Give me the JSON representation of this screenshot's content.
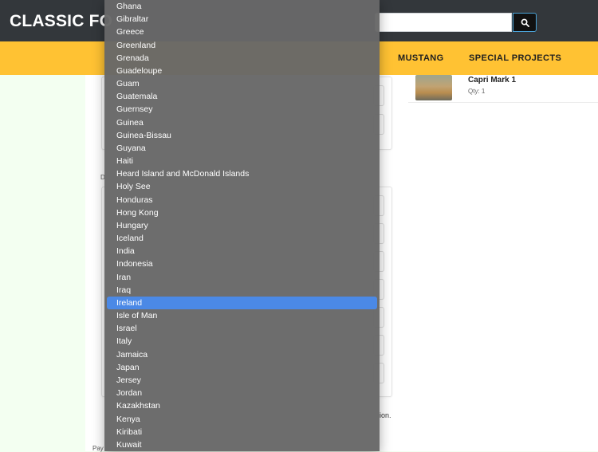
{
  "header": {
    "logo_text": "CLASSIC FO"
  },
  "nav": {
    "mustang": "MUSTANG",
    "special_projects": "SPECIAL PROJECTS"
  },
  "cart": {
    "item_name": "Capri Mark 1",
    "item_qty": "Qty: 1"
  },
  "background_text": {
    "label_d": "D",
    "suffix": "ion.",
    "footer_fragment": "Pay"
  },
  "dropdown": {
    "selected": "Ireland",
    "options": [
      "Ghana",
      "Gibraltar",
      "Greece",
      "Greenland",
      "Grenada",
      "Guadeloupe",
      "Guam",
      "Guatemala",
      "Guernsey",
      "Guinea",
      "Guinea-Bissau",
      "Guyana",
      "Haiti",
      "Heard Island and McDonald Islands",
      "Holy See",
      "Honduras",
      "Hong Kong",
      "Hungary",
      "Iceland",
      "India",
      "Indonesia",
      "Iran",
      "Iraq",
      "Ireland",
      "Isle of Man",
      "Israel",
      "Italy",
      "Jamaica",
      "Japan",
      "Jersey",
      "Jordan",
      "Kazakhstan",
      "Kenya",
      "Kiribati",
      "Kuwait"
    ]
  }
}
